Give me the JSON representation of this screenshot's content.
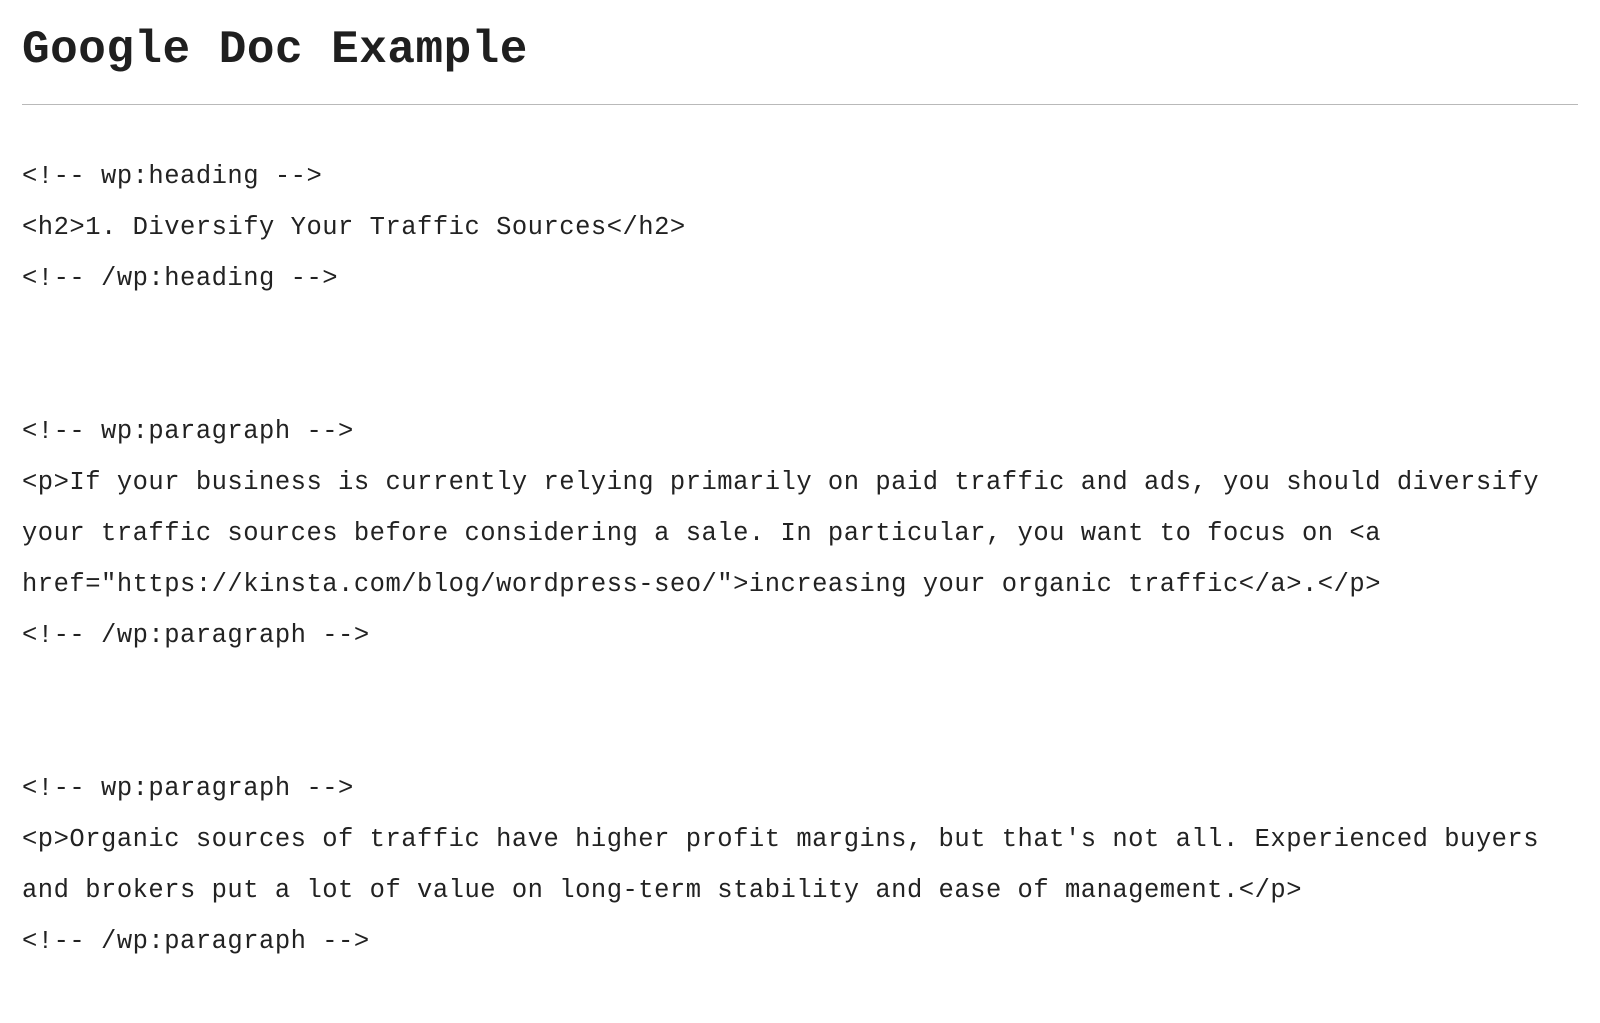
{
  "title": "Google Doc Example",
  "code_lines": [
    "<!-- wp:heading -->",
    "<h2>1. Diversify Your Traffic Sources</h2>",
    "<!-- /wp:heading -->",
    "",
    "",
    "<!-- wp:paragraph -->",
    "<p>If your business is currently relying primarily on paid traffic and ads, you should diversify your traffic sources before considering a sale. In particular, you want to focus on <a href=\"https://kinsta.com/blog/wordpress-seo/\">increasing your organic traffic</a>.</p>",
    "<!-- /wp:paragraph -->",
    "",
    "",
    "<!-- wp:paragraph -->",
    "<p>Organic sources of traffic have higher profit margins, but that's not all. Experienced buyers and brokers put a lot of value on long-term stability and ease of management.</p>",
    "<!-- /wp:paragraph -->"
  ]
}
